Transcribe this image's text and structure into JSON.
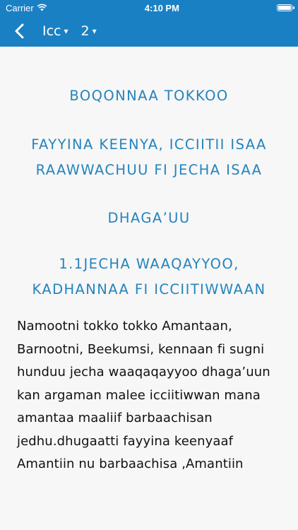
{
  "status_bar": {
    "carrier": "Carrier",
    "time": "4:10 PM"
  },
  "nav": {
    "book": "Icc",
    "chapter": "2",
    "caret": "▾"
  },
  "content": {
    "headings": [
      "BOQONNAA TOKKOO",
      "FAYYINA KEENYA, ICCIITII ISAA RAAWWACHUU FI JECHA ISAA",
      "DHAGA’UU",
      "1.1JECHA WAAQAYYOO, KADHANNAA FI ICCIITIWWAAN"
    ],
    "paragraph": "Namootni tokko tokko Amantaan, Barnootni, Beekumsi, kennaan fi sugni hunduu jecha waaqaqayyoo dhaga’uun kan argaman malee icciitiwwan mana amantaa maaliif barbaachisan jedhu.dhugaatti fayyina keenyaaf Amantiin nu barbaachisa ,Amantiin"
  },
  "colors": {
    "accent": "#1a80c4",
    "heading": "#2484bd",
    "background": "#f7f7f7"
  }
}
